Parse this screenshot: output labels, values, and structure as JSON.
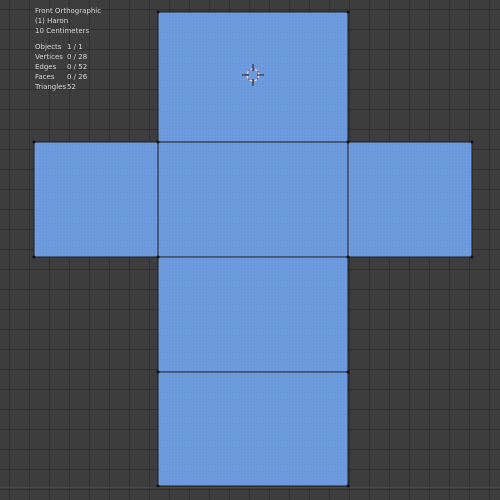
{
  "viewport": {
    "view_name": "Front Orthographic",
    "object_name": "(1) Haron",
    "grid_scale": "10 Centimeters"
  },
  "stats": [
    {
      "label": "Objects",
      "value": "1 / 1"
    },
    {
      "label": "Vertices",
      "value": "0 / 28"
    },
    {
      "label": "Edges",
      "value": "0 / 52"
    },
    {
      "label": "Faces",
      "value": "0 / 26"
    },
    {
      "label": "Triangles",
      "value": "52"
    }
  ],
  "colors": {
    "background": "#3d3d3d",
    "grid": "#303030",
    "face": "#6a98dc",
    "edge": "#1e1e1e",
    "x_axis": "#6a3b3b",
    "text": "#d8d8d8"
  },
  "icons": {
    "cursor": "3d-cursor-icon"
  }
}
